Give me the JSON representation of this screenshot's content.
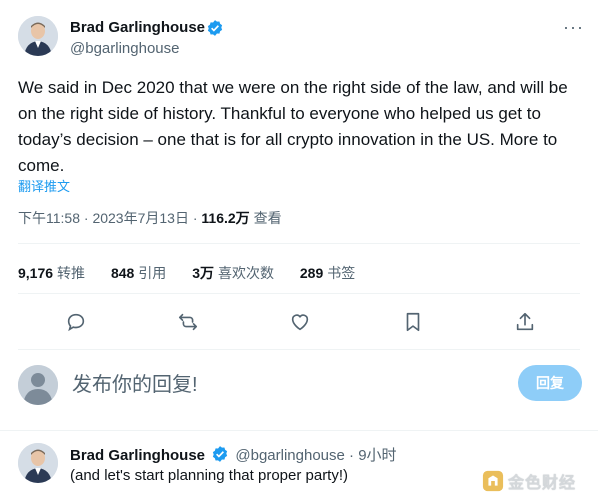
{
  "tweet": {
    "author_name": "Brad Garlinghouse",
    "author_handle": "@bgarlinghouse",
    "more_label": "···",
    "text": "We said in Dec 2020 that we were on the right side of the law, and will be on the right side of history. Thankful to everyone who helped us get to today’s decision – one that is for all crypto innovation in the US. More to come.",
    "translate_label": "翻译推文",
    "time": "下午11:58",
    "date": "2023年7月13日",
    "views_count": "116.2万",
    "views_label": "查看",
    "separator": "·"
  },
  "stats": [
    {
      "count": "9,176",
      "label": "转推"
    },
    {
      "count": "848",
      "label": "引用"
    },
    {
      "count": "3万",
      "label": "喜欢次数"
    },
    {
      "count": "289",
      "label": "书签"
    }
  ],
  "actions": [
    "reply-icon",
    "retweet-icon",
    "like-icon",
    "bookmark-icon",
    "share-icon"
  ],
  "composer": {
    "placeholder": "发布你的回复!",
    "reply_button": "回复"
  },
  "reply": {
    "author_name": "Brad Garlinghouse",
    "author_handle": "@bgarlinghouse",
    "time_ago": "9小时",
    "separator": "·",
    "text": "(and let's start planning that proper party!)"
  },
  "watermark": {
    "text": "金色财经"
  },
  "colors": {
    "accent": "#1d9bf0",
    "reply_button_disabled": "#8ecdf8",
    "muted": "#536471"
  }
}
